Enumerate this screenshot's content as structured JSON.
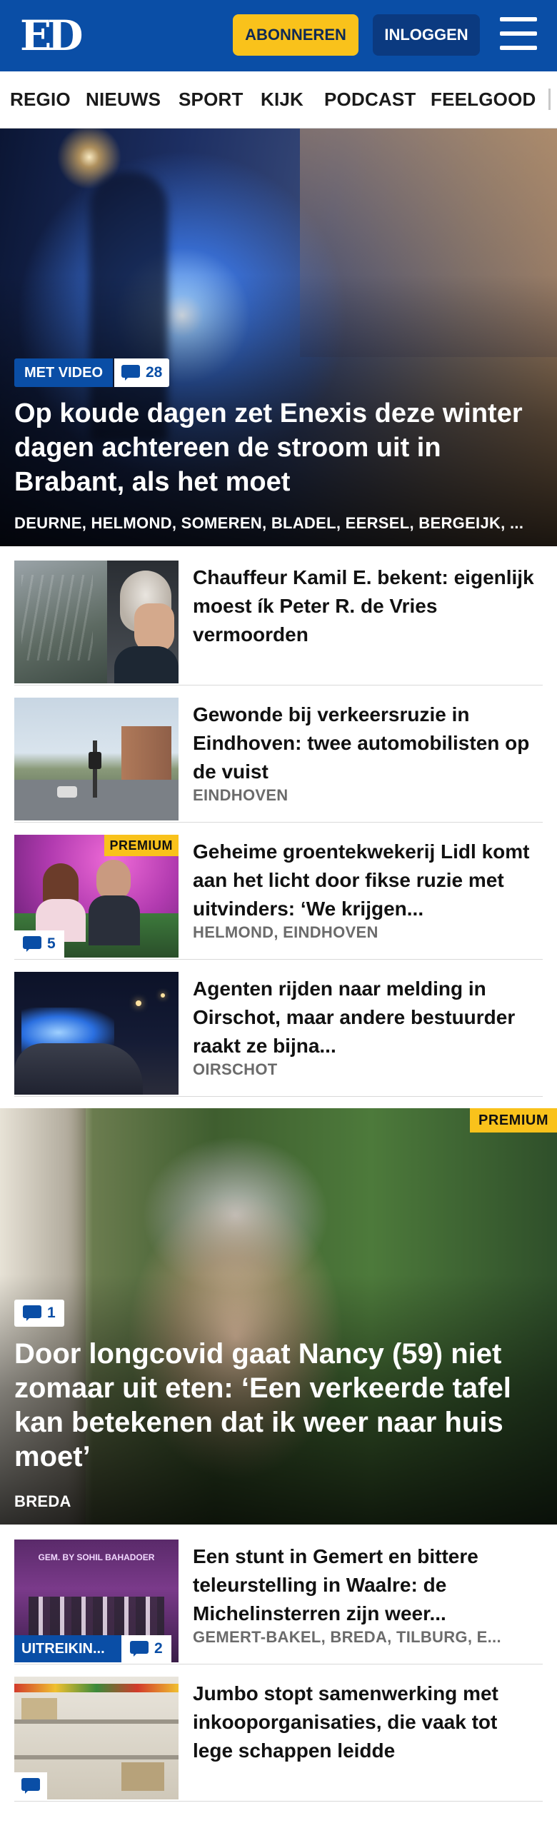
{
  "header": {
    "logo": "ED",
    "subscribe_label": "ABONNEREN",
    "login_label": "INLOGGEN",
    "colors": {
      "brand_blue": "#0a4ea6",
      "subscribe_yellow": "#f9c21b"
    }
  },
  "nav": {
    "items": [
      "REGIO",
      "NIEUWS",
      "SPORT",
      "KIJK",
      "PODCAST",
      "FEELGOOD"
    ]
  },
  "hero": {
    "badge": "MET VIDEO",
    "comments": "28",
    "title": "Op koude dagen zet Enexis deze winter dagen achtereen de stroom uit in Brabant, als het moet",
    "location": "DEURNE, HELMOND, SOMEREN, BLADEL, EERSEL, BERGEIJK, ..."
  },
  "articles": [
    {
      "title": "Chauffeur Kamil E. bekent: eigenlijk moest ík Peter R. de Vries vermoorden",
      "location": ""
    },
    {
      "title": "Gewonde bij verkeersruzie in Eindhoven: twee automobilisten op de vuist",
      "location": "EINDHOVEN"
    },
    {
      "title": "Geheime groentekwekerij Lidl komt aan het licht door fikse ruzie met uitvinders: ‘We krijgen...",
      "location": "HELMOND, EINDHOVEN",
      "premium": "PREMIUM",
      "comments": "5"
    },
    {
      "title": "Agenten rijden naar melding in Oirschot, maar andere bestuurder raakt ze bijna...",
      "location": "OIRSCHOT"
    }
  ],
  "feature": {
    "premium": "PREMIUM",
    "comments": "1",
    "title": "Door longcovid gaat Nancy (59) niet zomaar uit eten: ‘Een verkeerde tafel kan betekenen dat ik weer naar huis moet’",
    "location": "BREDA"
  },
  "articles2": [
    {
      "title": "Een stunt in Gemert en bittere teleurstelling in Waalre: de Michelinsterren zijn weer...",
      "location": "GEMERT-BAKEL, BREDA, TILBURG, E...",
      "badge": "UITREIKIN...",
      "comments": "2",
      "photo_text": "GEM. BY SOHIL BAHADOER"
    },
    {
      "title": "Jumbo stopt samenwerking met inkooporganisaties, die vaak tot lege schappen leidde",
      "location": ""
    }
  ],
  "icons": [
    "comment-icon",
    "menu-icon"
  ]
}
